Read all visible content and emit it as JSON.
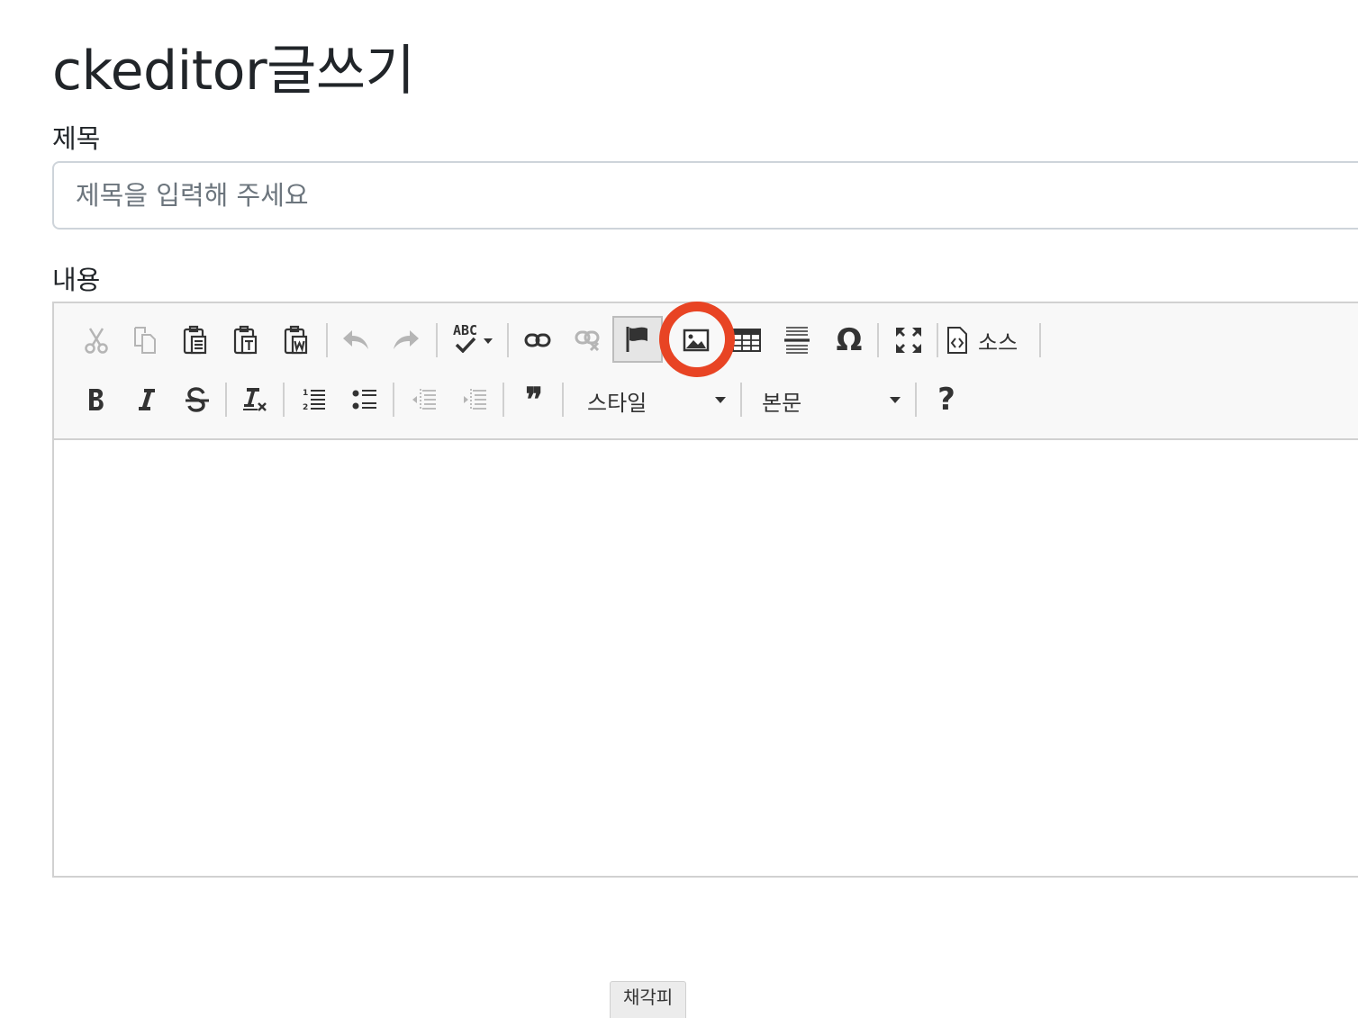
{
  "page": {
    "title": "ckeditor글쓰기"
  },
  "form": {
    "title_label": "제목",
    "title_placeholder": "제목을 입력해 주세요",
    "title_value": "",
    "content_label": "내용"
  },
  "toolbar": {
    "source_label": "소스",
    "style_combo": "스타일",
    "format_combo": "본문",
    "help_label": "?",
    "special_char_label": "Ω",
    "blockquote_label": "❞",
    "spellcheck_label": "ABC"
  },
  "editor": {
    "status_tag": "채각피"
  },
  "colors": {
    "highlight_ring": "#e84424",
    "toolbar_bg": "#f8f8f8",
    "border": "#d1d1d1"
  }
}
